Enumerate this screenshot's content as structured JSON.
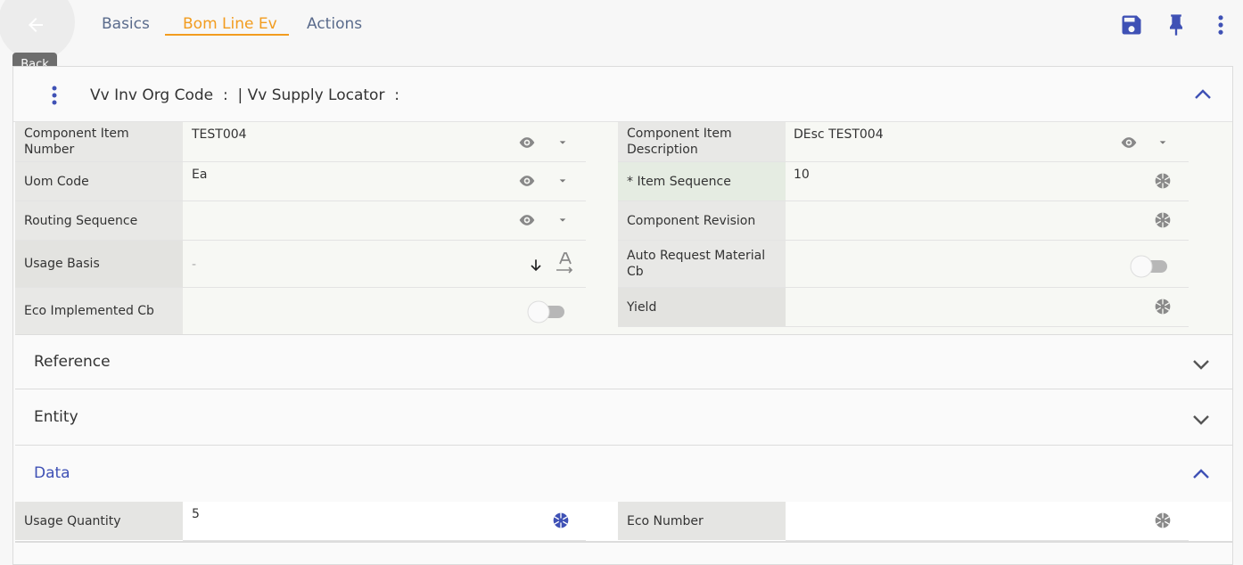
{
  "toolbar": {
    "back_tooltip": "Back",
    "tabs": [
      {
        "label": "Basics",
        "active": false
      },
      {
        "label": "Bom Line Ev",
        "active": true
      },
      {
        "label": "Actions",
        "active": false
      }
    ],
    "icons": [
      "save-icon",
      "pin-icon",
      "more-vertical-icon"
    ]
  },
  "header": {
    "title": "Vv Inv Org Code  :  | Vv Supply Locator  :"
  },
  "fields": {
    "component_item_number": {
      "label": "Component Item Number",
      "value": "TEST004"
    },
    "component_item_description": {
      "label": "Component Item Description",
      "value": "DEsc TEST004"
    },
    "uom_code": {
      "label": "Uom Code",
      "value": "Ea"
    },
    "item_sequence": {
      "label": "* Item Sequence",
      "value": "10"
    },
    "routing_sequence": {
      "label": "Routing Sequence",
      "value": ""
    },
    "component_revision": {
      "label": "Component Revision",
      "value": ""
    },
    "usage_basis": {
      "label": "Usage Basis",
      "value": "-"
    },
    "auto_request_material_cb": {
      "label": "Auto Request Material Cb",
      "checked": false
    },
    "eco_implemented_cb": {
      "label": "Eco Implemented Cb",
      "checked": false
    },
    "yield": {
      "label": "Yield",
      "value": ""
    }
  },
  "sections": {
    "reference": "Reference",
    "entity": "Entity",
    "data": "Data"
  },
  "data_fields": {
    "usage_quantity": {
      "label": "Usage Quantity",
      "value": "5"
    },
    "eco_number": {
      "label": "Eco Number",
      "value": ""
    }
  },
  "colors": {
    "accent": "#f29c1f",
    "primary": "#3f51b5",
    "label_bg": "#e8e8e6",
    "field_bg": "#f7f8f4"
  }
}
